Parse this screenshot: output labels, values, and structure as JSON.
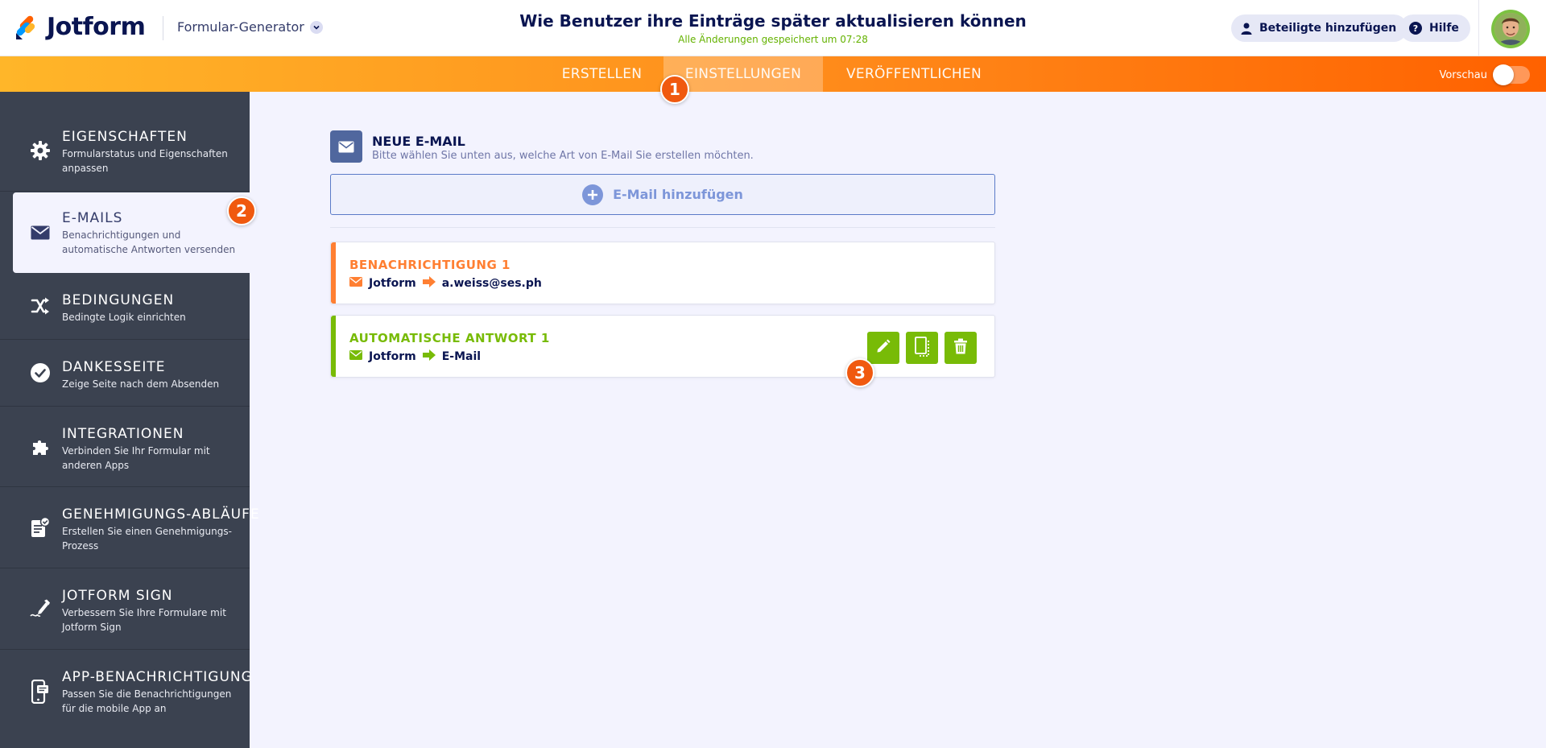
{
  "header": {
    "logo_text": "Jotform",
    "builder_switch": "Formular-Generator",
    "form_title": "Wie Benutzer ihre Einträge später aktualisieren können",
    "save_status": "Alle Änderungen gespeichert um 07:28",
    "share_label": "Beteiligte hinzufügen",
    "help_label": "Hilfe"
  },
  "nav": {
    "tabs": [
      {
        "label": "ERSTELLEN"
      },
      {
        "label": "EINSTELLUNGEN"
      },
      {
        "label": "VERÖFFENTLICHEN"
      }
    ],
    "preview_label": "Vorschau",
    "preview_on": false
  },
  "markers": [
    "1",
    "2",
    "3"
  ],
  "sidebar": {
    "items": [
      {
        "title": "EIGENSCHAFTEN",
        "desc": "Formularstatus und Eigenschaften anpassen",
        "icon": "gear-icon"
      },
      {
        "title": "E-MAILS",
        "desc": "Benachrichtigungen und automatische Antworten versenden",
        "icon": "envelope-icon"
      },
      {
        "title": "BEDINGUNGEN",
        "desc": "Bedingte Logik einrichten",
        "icon": "shuffle-icon"
      },
      {
        "title": "DANKESSEITE",
        "desc": "Zeige Seite nach dem Absenden",
        "icon": "check-circle-icon"
      },
      {
        "title": "INTEGRATIONEN",
        "desc": "Verbinden Sie Ihr Formular mit anderen Apps",
        "icon": "puzzle-icon"
      },
      {
        "title": "GENEHMIGUNGS-ABLÄUFE",
        "desc": "Erstellen Sie einen Genehmigungs-Prozess",
        "icon": "approval-icon"
      },
      {
        "title": "JOTFORM SIGN",
        "desc": "Verbessern Sie Ihre Formulare mit Jotform Sign",
        "icon": "signature-pen-icon"
      },
      {
        "title": "APP-BENACHRICHTIGUNG",
        "desc": "Passen Sie die Benachrichtigungen für die mobile App an",
        "icon": "mobile-notification-icon"
      }
    ]
  },
  "main": {
    "new_email_title": "NEUE E-MAIL",
    "new_email_sub": "Bitte wählen Sie unten aus, welche Art von E-Mail Sie erstellen möchten.",
    "add_email_label": "E-Mail hinzufügen",
    "cards": [
      {
        "title": "BENACHRICHTIGUNG 1",
        "from": "Jotform",
        "to": "a.weiss@ses.ph",
        "color": "#ff7f32"
      },
      {
        "title": "AUTOMATISCHE ANTWORT 1",
        "from": "Jotform",
        "to": "E-Mail",
        "color": "#78bb07"
      }
    ]
  },
  "colors": {
    "accent_orange": "#ff6100",
    "sidebar_bg": "#3b4250",
    "autoresponder_green": "#78bb07",
    "notification_orange": "#ff7f32",
    "marker": "#f0590f"
  }
}
